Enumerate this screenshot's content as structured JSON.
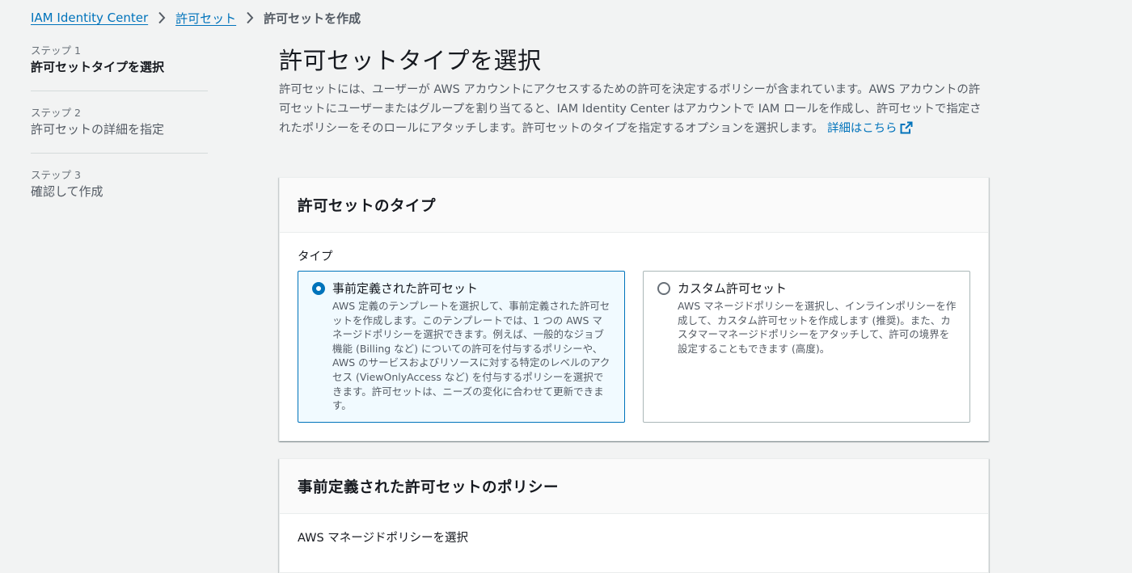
{
  "breadcrumb": {
    "items": [
      "IAM Identity Center",
      "許可セット"
    ],
    "current": "許可セットを作成"
  },
  "steps": [
    {
      "num": "ステップ 1",
      "title": "許可セットタイプを選択"
    },
    {
      "num": "ステップ 2",
      "title": "許可セットの詳細を指定"
    },
    {
      "num": "ステップ 3",
      "title": "確認して作成"
    }
  ],
  "page": {
    "title": "許可セットタイプを選択",
    "description": "許可セットには、ユーザーが AWS アカウントにアクセスするための許可を決定するポリシーが含まれています。AWS アカウントの許可セットにユーザーまたはグループを割り当てると、IAM Identity Center はアカウントで IAM ロールを作成し、許可セットで指定されたポリシーをそのロールにアタッチします。許可セットのタイプを指定するオプションを選択します。",
    "learn_more": "詳細はこちら"
  },
  "type_card": {
    "header": "許可セットのタイプ",
    "field_label": "タイプ",
    "options": [
      {
        "title": "事前定義された許可セット",
        "description": "AWS 定義のテンプレートを選択して、事前定義された許可セットを作成します。このテンプレートでは、1 つの AWS マネージドポリシーを選択できます。例えば、一般的なジョブ機能 (Billing など) についての許可を付与するポリシーや、AWS のサービスおよびリソースに対する特定のレベルのアクセス (ViewOnlyAccess など) を付与するポリシーを選択できます。許可セットは、ニーズの変化に合わせて更新できます。",
        "selected": true
      },
      {
        "title": "カスタム許可セット",
        "description": "AWS マネージドポリシーを選択し、インラインポリシーを作成して、カスタム許可セットを作成します (推奨)。また、カスタマーマネージドポリシーをアタッチして、許可の境界を設定することもできます (高度)。",
        "selected": false
      }
    ]
  },
  "policy_card": {
    "header": "事前定義された許可セットのポリシー",
    "field_label": "AWS マネージドポリシーを選択"
  },
  "colors": {
    "link": "#0073bb",
    "selected_border": "#0073bb",
    "selected_bg": "#f1faff",
    "page_bg": "#f2f3f3"
  }
}
